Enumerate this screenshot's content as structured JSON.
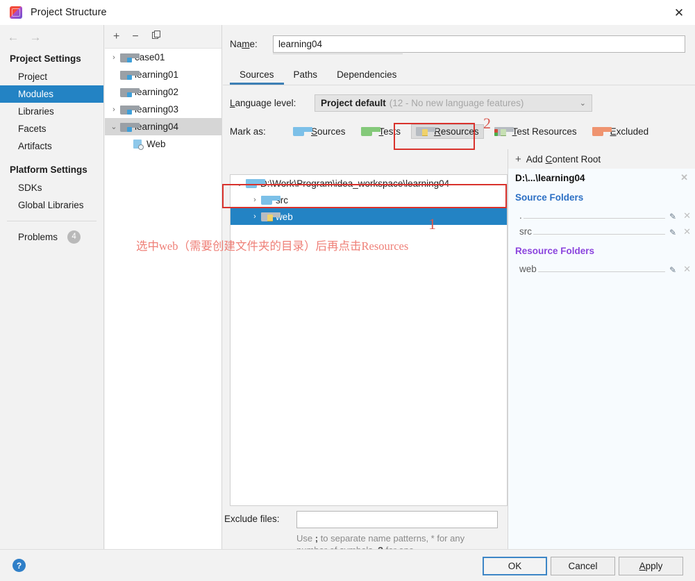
{
  "window": {
    "title": "Project Structure",
    "app_icon": "intellij-idea-icon",
    "close_label": "✕"
  },
  "left_nav": {
    "back_arrow": "←",
    "forward_arrow": "→",
    "groups": [
      {
        "title": "Project Settings",
        "items": [
          {
            "label": "Project",
            "selected": false
          },
          {
            "label": "Modules",
            "selected": true
          },
          {
            "label": "Libraries",
            "selected": false
          },
          {
            "label": "Facets",
            "selected": false
          },
          {
            "label": "Artifacts",
            "selected": false
          }
        ]
      },
      {
        "title": "Platform Settings",
        "items": [
          {
            "label": "SDKs",
            "selected": false
          },
          {
            "label": "Global Libraries",
            "selected": false
          }
        ]
      }
    ],
    "problems": {
      "label": "Problems",
      "count": "4"
    }
  },
  "module_panel": {
    "toolbar": {
      "add": "+",
      "remove": "−",
      "copy": "copy-icon"
    },
    "items": [
      {
        "label": "case01",
        "twisty": "›",
        "icon": "module-folder-icon",
        "selected": false,
        "indent": 0
      },
      {
        "label": "learning01",
        "twisty": "",
        "icon": "module-folder-icon",
        "selected": false,
        "indent": 0
      },
      {
        "label": "learning02",
        "twisty": "",
        "icon": "module-folder-icon",
        "selected": false,
        "indent": 0
      },
      {
        "label": "learning03",
        "twisty": "›",
        "icon": "module-folder-icon",
        "selected": false,
        "indent": 0
      },
      {
        "label": "learning04",
        "twisty": "⌄",
        "icon": "module-folder-icon",
        "selected": true,
        "indent": 0
      },
      {
        "label": "Web",
        "twisty": "",
        "icon": "web-facet-icon",
        "selected": false,
        "indent": 1
      }
    ]
  },
  "main": {
    "name_label_pre": "Na",
    "name_label_accel": "m",
    "name_label_post": "e:",
    "name_value": "learning04",
    "tabs": [
      {
        "label": "Sources",
        "active": true
      },
      {
        "label": "Paths",
        "active": false
      },
      {
        "label": "Dependencies",
        "active": false
      }
    ],
    "language_level": {
      "label_accel": "L",
      "label_rest": "anguage level:",
      "value": "Project default",
      "hint": "(12 - No new language features)",
      "chevron": "⌄"
    },
    "mark_as": {
      "label": "Mark as:",
      "buttons": [
        {
          "accel": "S",
          "rest": "ources",
          "icon": "sources-folder-icon",
          "pressed": false
        },
        {
          "accel": "T",
          "rest": "ests",
          "icon": "tests-folder-icon",
          "pressed": false
        },
        {
          "accel": "R",
          "rest": "esources",
          "icon": "resources-folder-icon",
          "pressed": true
        },
        {
          "accel": "T",
          "rest": "est Resources",
          "icon": "test-resources-folder-icon",
          "pressed": false
        },
        {
          "accel": "E",
          "rest": "xcluded",
          "icon": "excluded-folder-icon",
          "pressed": false
        }
      ]
    },
    "tree": [
      {
        "label": "D:\\Work\\Program\\idea_workspace\\learning04",
        "twisty": "⌄",
        "icon": "content-root-folder-icon",
        "indent": 0,
        "selected": false
      },
      {
        "label": "src",
        "twisty": "›",
        "icon": "sources-folder-icon",
        "indent": 1,
        "selected": false
      },
      {
        "label": "web",
        "twisty": "›",
        "icon": "resources-folder-icon",
        "indent": 1,
        "selected": true
      }
    ],
    "exclude": {
      "label": "Exclude files:",
      "value": "",
      "help_pre": "Use ",
      "help_semicolon": ";",
      "help_mid": " to separate name patterns, * for any number of symbols, ",
      "help_q": "?",
      "help_end": " for one."
    }
  },
  "right_panel": {
    "add_content_root": {
      "plus": "+",
      "pre": "Add ",
      "accel": "C",
      "rest": "ontent Root"
    },
    "root": {
      "label": "D:\\...\\learning04",
      "close": "✕"
    },
    "source_folders": {
      "title": "Source Folders",
      "items": [
        {
          "name": ".",
          "edit": "pencil-icon",
          "remove": "✕"
        },
        {
          "name": "src",
          "edit": "pencil-icon",
          "remove": "✕"
        }
      ]
    },
    "resource_folders": {
      "title": "Resource Folders",
      "items": [
        {
          "name": "web",
          "edit": "pencil-icon",
          "remove": "✕"
        }
      ]
    }
  },
  "annotations": {
    "number_one": "1",
    "number_two": "2",
    "note": "选中web（需要创建文件夹的目录）后再点击Resources",
    "box_color": "#d9322c",
    "text_color": "#ef8078"
  },
  "footer": {
    "help": "?",
    "ok": "OK",
    "cancel": "Cancel",
    "apply_accel": "A",
    "apply_rest": "pply"
  }
}
